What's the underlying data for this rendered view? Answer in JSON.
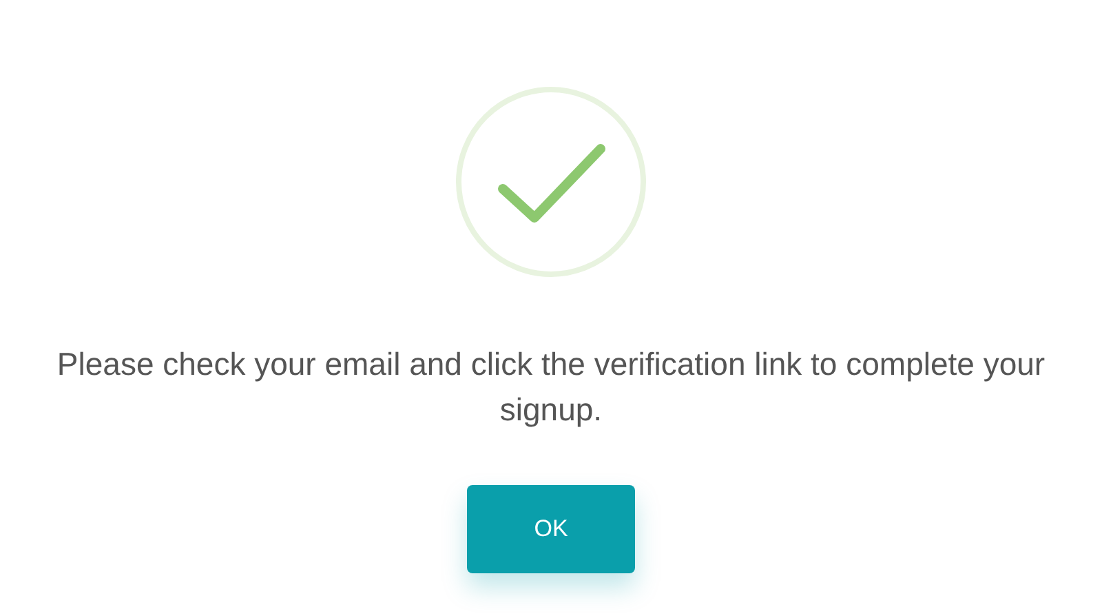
{
  "message": "Please check your email and click the verification link to complete your signup.",
  "button": {
    "label": "OK"
  }
}
